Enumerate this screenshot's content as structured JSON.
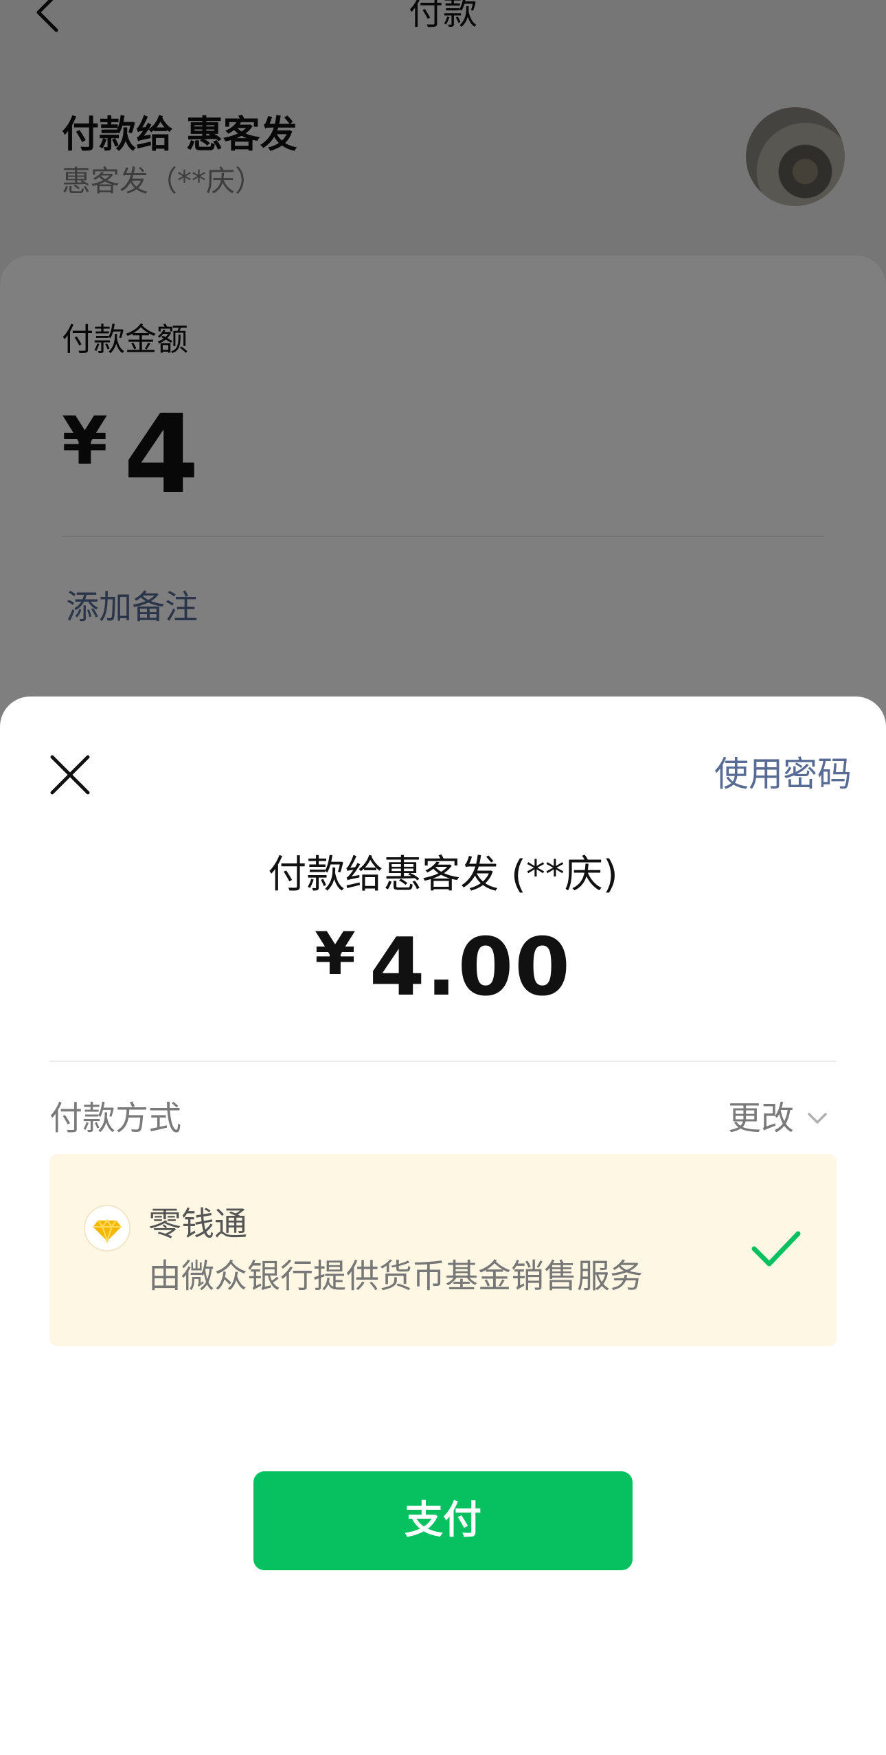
{
  "nav": {
    "title": "付款",
    "back_icon": "chevron-left-icon"
  },
  "payee": {
    "title": "付款给 惠客发",
    "subtitle": "惠客发（**庆）"
  },
  "amount_card": {
    "label": "付款金额",
    "currency": "¥",
    "value": "4",
    "add_note": "添加备注"
  },
  "sheet": {
    "close_icon": "close-icon",
    "use_password": "使用密码",
    "payee_line": "付款给惠客发 (**庆)",
    "currency": "¥",
    "amount": "4.00",
    "method_label": "付款方式",
    "change_label": "更改",
    "method": {
      "icon": "diamond-icon",
      "name": "零钱通",
      "description": "由微众银行提供货币基金销售服务",
      "selected": true
    },
    "pay_button": "支付"
  },
  "colors": {
    "accent_green": "#07c160",
    "link_blue": "#576b95",
    "method_card_bg": "#fdf7e4",
    "diamond_gold": "#f5b800"
  }
}
